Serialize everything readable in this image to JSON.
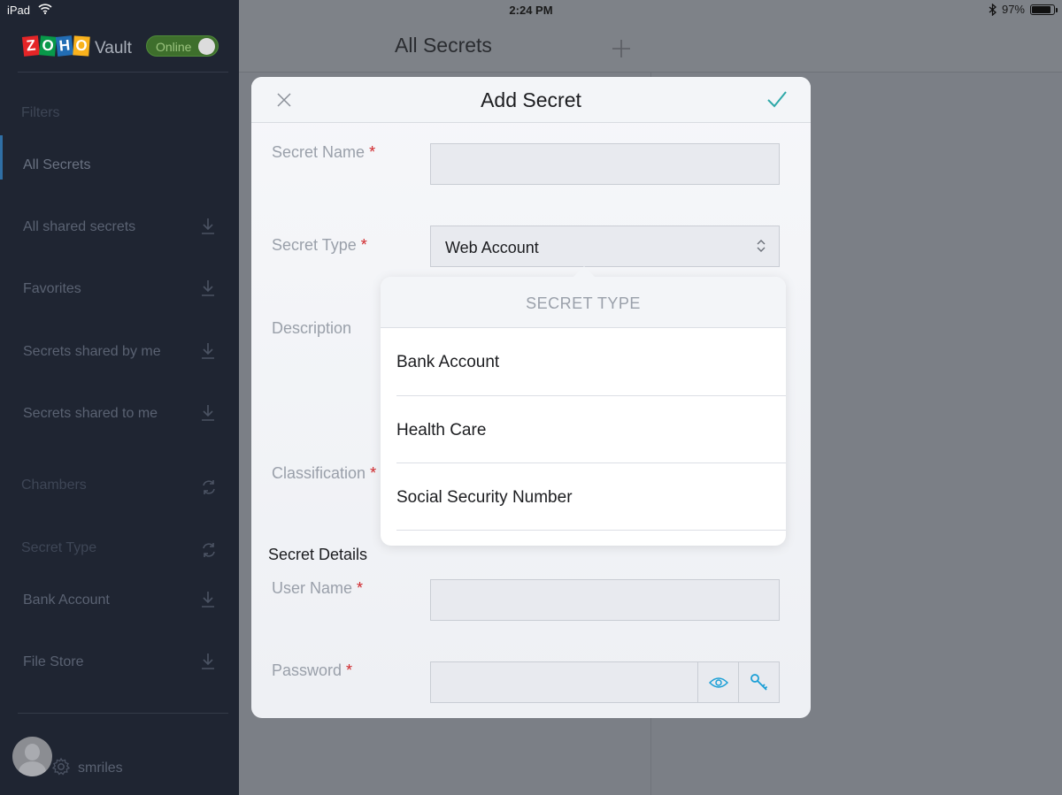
{
  "status_bar": {
    "device": "iPad",
    "time": "2:24 PM",
    "battery": "97%",
    "battery_level": 0.97
  },
  "sidebar": {
    "logo_letters": [
      "Z",
      "O",
      "H",
      "O"
    ],
    "logo_colors": [
      "#e42527",
      "#089949",
      "#226db4",
      "#f9b21d"
    ],
    "product_name": "Vault",
    "online_label": "Online",
    "filters_heading": "Filters",
    "items": [
      {
        "label": "All Secrets",
        "icon": ""
      },
      {
        "label": "All shared secrets",
        "icon": "download-icon"
      },
      {
        "label": "Favorites",
        "icon": "download-icon"
      },
      {
        "label": "Secrets shared by me",
        "icon": "download-icon"
      },
      {
        "label": "Secrets shared to me",
        "icon": "download-icon"
      }
    ],
    "chambers_heading": "Chambers",
    "secret_type_heading": "Secret Type",
    "type_items": [
      {
        "label": "Bank Account",
        "icon": "download-icon"
      },
      {
        "label": "File Store",
        "icon": "download-icon"
      }
    ],
    "username": "smriles"
  },
  "main": {
    "title": "All Secrets"
  },
  "modal": {
    "title": "Add Secret",
    "fields": {
      "secret_name": "Secret Name",
      "secret_type": "Secret Type",
      "secret_type_value": "Web Account",
      "description": "Description",
      "classification": "Classification",
      "secret_details": "Secret Details",
      "user_name": "User Name",
      "password": "Password"
    },
    "required_mark": "*"
  },
  "popover": {
    "title": "SECRET TYPE",
    "options": [
      "Bank Account",
      "Health Care",
      "Social Security Number"
    ]
  },
  "colors": {
    "accent": "#1a9fd6",
    "check": "#2ea8a8",
    "required": "#d0282c",
    "sidebar_bg": "#1f2532"
  }
}
